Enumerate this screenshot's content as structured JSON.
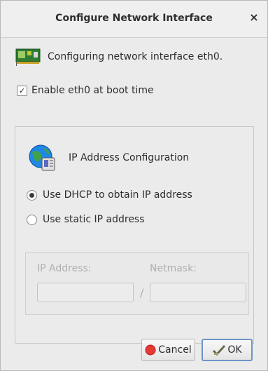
{
  "dialog": {
    "title": "Configure Network Interface",
    "close_glyph": "×"
  },
  "header": {
    "icon": "network-card-icon",
    "text": "Configuring network interface eth0."
  },
  "boot": {
    "label": "Enable eth0 at boot time",
    "checked": true,
    "check_glyph": "✓"
  },
  "ip_config": {
    "icon": "network-globe-icon",
    "title": "IP Address Configuration",
    "options": [
      {
        "label": "Use DHCP to obtain IP address",
        "selected": true
      },
      {
        "label": "Use static IP address",
        "selected": false
      }
    ],
    "static": {
      "ip_label": "IP Address:",
      "netmask_label": "Netmask:",
      "ip_value": "",
      "netmask_value": "",
      "separator": "/"
    }
  },
  "buttons": {
    "cancel": "Cancel",
    "ok": "OK"
  },
  "colors": {
    "cancel_icon": "#e53935",
    "ok_border": "#6d95c8"
  }
}
